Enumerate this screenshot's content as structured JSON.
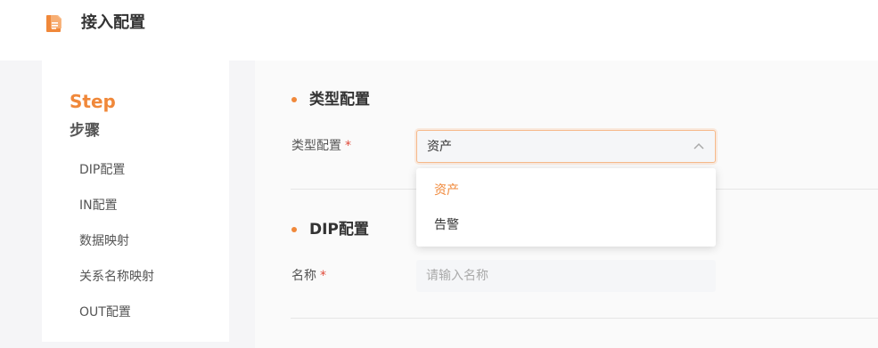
{
  "header": {
    "title": "接入配置",
    "logo_icon": "document-logo-icon"
  },
  "sidebar": {
    "step_en": "Step",
    "step_cn": "步骤",
    "items": [
      {
        "label": "DIP配置"
      },
      {
        "label": "IN配置"
      },
      {
        "label": "数据映射"
      },
      {
        "label": "关系名称映射"
      },
      {
        "label": "OUT配置"
      }
    ]
  },
  "type_section": {
    "title": "类型配置",
    "field_label": "类型配置",
    "required_mark": "*",
    "selected_value": "资产",
    "options": [
      "资产",
      "告警"
    ]
  },
  "dip_section": {
    "title": "DIP配置",
    "name_label": "名称",
    "required_mark": "*",
    "name_placeholder": "请输入名称",
    "name_value": ""
  },
  "colors": {
    "accent": "#f0883a",
    "required": "#e04a3a",
    "focus_border": "#f6b98a"
  }
}
